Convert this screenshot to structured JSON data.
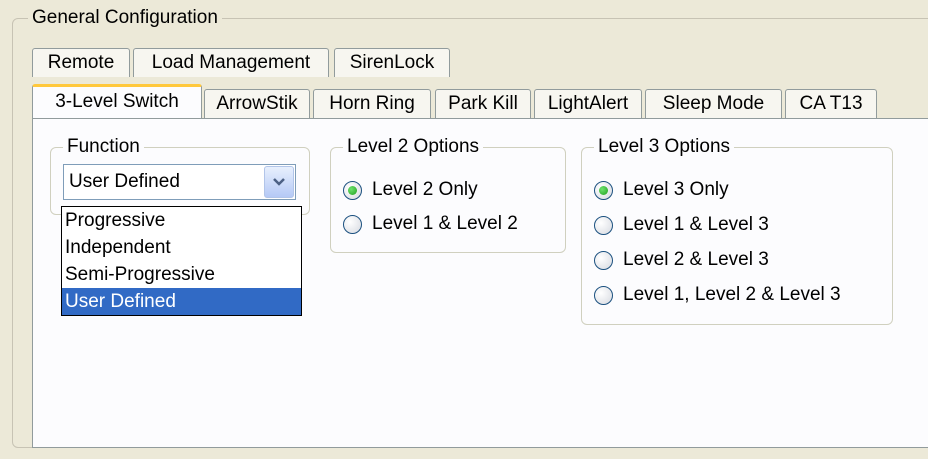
{
  "group_title": "General Configuration",
  "tabs_row1": [
    {
      "label": "Remote"
    },
    {
      "label": "Load Management"
    },
    {
      "label": "SirenLock"
    }
  ],
  "tabs_row2": [
    {
      "label": "3-Level Switch",
      "active": true
    },
    {
      "label": "ArrowStik"
    },
    {
      "label": "Horn Ring"
    },
    {
      "label": "Park Kill"
    },
    {
      "label": "LightAlert"
    },
    {
      "label": "Sleep Mode"
    },
    {
      "label": "CA T13"
    }
  ],
  "function": {
    "legend": "Function",
    "selected": "User Defined",
    "options": [
      "Progressive",
      "Independent",
      "Semi-Progressive",
      "User Defined"
    ]
  },
  "level2": {
    "legend": "Level 2 Options",
    "options": [
      {
        "label": "Level 2 Only",
        "checked": true
      },
      {
        "label": "Level 1 & Level 2",
        "checked": false
      }
    ]
  },
  "level3": {
    "legend": "Level 3 Options",
    "options": [
      {
        "label": "Level 3 Only",
        "checked": true
      },
      {
        "label": "Level 1 & Level 3",
        "checked": false
      },
      {
        "label": "Level 2 & Level 3",
        "checked": false
      },
      {
        "label": "Level 1, Level 2 & Level 3",
        "checked": false
      }
    ]
  },
  "colors": {
    "accent_tab": "#ffc83c",
    "selection": "#316ac5",
    "radio_dot": "#21a121"
  }
}
